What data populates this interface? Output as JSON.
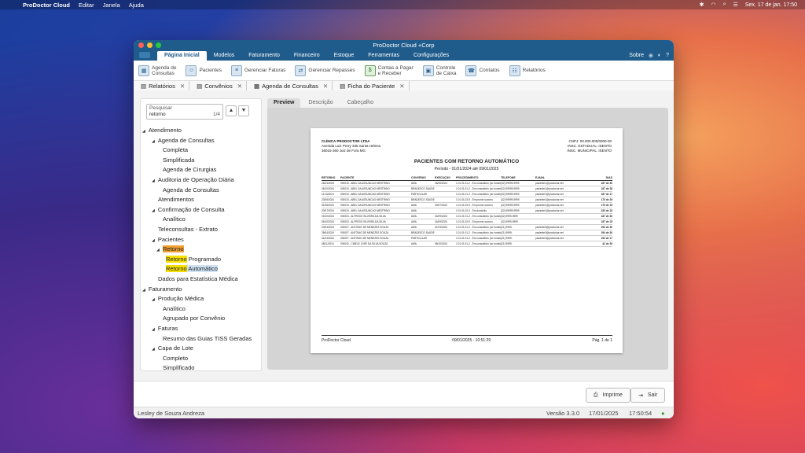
{
  "menubar": {
    "app": "ProDoctor Cloud",
    "items": [
      "Editar",
      "Janela",
      "Ajuda"
    ],
    "datetime": "Sex. 17 de jan.  17:50"
  },
  "window": {
    "title": "ProDoctor Cloud +Corp",
    "ribbon_tabs": [
      "Página Inicial",
      "Modelos",
      "Faturamento",
      "Financeiro",
      "Estoque",
      "Ferramentas",
      "Configurações"
    ],
    "ribbon_right": "Sobre",
    "toolbar": [
      {
        "label": "Agenda de\nConsultas",
        "icon": "calendar-icon"
      },
      {
        "label": "Pacientes",
        "icon": "patients-icon"
      },
      {
        "label": "Gerenciar Faturas",
        "icon": "invoices-icon"
      },
      {
        "label": "Gerenciar Repasses",
        "icon": "transfers-icon"
      },
      {
        "label": "Contas a Pagar\ne Receber",
        "icon": "accounts-icon"
      },
      {
        "label": "Controle\nde Caixa",
        "icon": "cashier-icon"
      },
      {
        "label": "Contatos",
        "icon": "contacts-icon"
      },
      {
        "label": "Relatórios",
        "icon": "reports-icon"
      }
    ],
    "doc_tabs": [
      "Relatórios",
      "Convênios",
      "Agenda de Consultas",
      "Ficha do Paciente"
    ]
  },
  "search": {
    "placeholder": "Pesquisar",
    "value": "retorno",
    "count": "1/4"
  },
  "tree": [
    {
      "label": "Atendimento",
      "level": 0,
      "expanded": true
    },
    {
      "label": "Agenda de Consultas",
      "level": 1,
      "expanded": true
    },
    {
      "label": "Completa",
      "level": 2
    },
    {
      "label": "Simplificada",
      "level": 2
    },
    {
      "label": "Agenda de Cirurgias",
      "level": 2
    },
    {
      "label": "Auditoria de Operação Diária",
      "level": 1,
      "expanded": true
    },
    {
      "label": "Agenda de Consultas",
      "level": 2
    },
    {
      "label": "Atendimentos",
      "level": 1
    },
    {
      "label": "Confirmação de Consulta",
      "level": 1,
      "expanded": true
    },
    {
      "label": "Analítico",
      "level": 2
    },
    {
      "label": "Teleconsultas - Extrato",
      "level": 1
    },
    {
      "label": "Pacientes",
      "level": 1,
      "expanded": true
    },
    {
      "label": "Retorno",
      "level": 2,
      "expanded": true,
      "match": "Retorno",
      "rest": "",
      "hl": "orange"
    },
    {
      "label": "Retorno Programado",
      "level": 3,
      "match": "Retorno",
      "rest": " Programado",
      "hl": "yellow"
    },
    {
      "label": "Retorno Automático",
      "level": 3,
      "match": "Retorno",
      "rest": " Automático",
      "hl": "yellow",
      "selected": true
    },
    {
      "label": "Dados para Estatística Médica",
      "level": 1
    },
    {
      "label": "Faturamento",
      "level": 0,
      "expanded": true
    },
    {
      "label": "Produção Médica",
      "level": 1,
      "expanded": true
    },
    {
      "label": "Analítico",
      "level": 2
    },
    {
      "label": "Agrupado por Convênio",
      "level": 2
    },
    {
      "label": "Faturas",
      "level": 1,
      "expanded": true
    },
    {
      "label": "Resumo das Guias TISS Geradas",
      "level": 2
    },
    {
      "label": "Capa de Lote",
      "level": 1,
      "expanded": true
    },
    {
      "label": "Completo",
      "level": 2
    },
    {
      "label": "Simplificado",
      "level": 2
    }
  ],
  "preview_tabs": [
    "Preview",
    "Descrição",
    "Cabeçalho"
  ],
  "report": {
    "company": "CLÍNICA PRODOCTOR LTDA",
    "address1": "Avenida Luiz Perry 335 Santa Helena",
    "address2": "36015-360 Juiz de Fora MG",
    "cnpj": "CNPJ: 00.000.000/0000-00",
    "insc_est": "INSC. ESTADUAL: ISENTO",
    "insc_mun": "INSC. MUNICIPAL: ISENTO",
    "title": "PACIENTES COM RETORNO AUTOMÁTICO",
    "period": "Período - 01/01/2024 até 09/01/2025",
    "columns": [
      "RETORNO",
      "PACIENTE",
      "CONVÊNIO",
      "EXECUÇÃO",
      "PROCEDIMENTO",
      "TELEFONE",
      "E-MAIL",
      "DIAS"
    ],
    "rows": [
      [
        "26/03/2024",
        "000015 - ABEL DA ASSUNCAO MESTRINO",
        "AMIL",
        "26/06/2024",
        "1.01.01.01-2 - Em consultório (no horário normal ou pré...",
        "(32) 99999-9999",
        "paciente1@prodoctor.net",
        "187 de 30"
      ],
      [
        "26/10/2024",
        "000015 - ABEL DA ASSUNCAO MESTRINO",
        "BRADESCO SAÚDE",
        "",
        "1.01.01.01-2 - Em consultório (no horário normal ou pré...",
        "(32) 99999-9999",
        "paciente1@prodoctor.net",
        "187 de 28"
      ],
      [
        "11/10/2024",
        "000015 - ABEL DA ASSUNCAO MESTRINO",
        "PARTICULAR",
        "",
        "1.01.01.01-2 - Em consultório (no horário normal ou pré...",
        "(32) 99999-9999",
        "paciente1@prodoctor.net",
        "187 de 17"
      ],
      [
        "23/08/2024",
        "000015 - ABEL DA ASSUNCAO MESTRINO",
        "BRADESCO SAÚDE",
        "",
        "1.01.01.03-9 - Em pronto socorro",
        "(32) 99999-9999",
        "paciente1@prodoctor.net",
        "170 de 29"
      ],
      [
        "31/08/2024",
        "000015 - ABEL DA ASSUNCAO MESTRINO",
        "AMIL",
        "20/07/2024",
        "1.01.01.03-9 - Em pronto socorro",
        "(32) 99999-9999",
        "paciente1@prodoctor.net",
        "170 de 15"
      ],
      [
        "20/07/2024",
        "000015 - ABEL DA ASSUNCAO MESTRINO",
        "AMIL",
        "",
        "1.01.01.02-0 - Em domicílio",
        "(32) 99999-9999",
        "paciente1@prodoctor.net",
        "333 de 15"
      ],
      [
        "24/10/2024",
        "000003 - ALFREDO SILVEIRA DA SILVA",
        "AMIL",
        "24/09/2024",
        "1.01.01.01-2 - Em consultório (no horário normal ou pré...",
        "(32) 9999-9999",
        "",
        "187 de 30"
      ],
      [
        "06/10/2024",
        "000003 - ALFREDO SILVEIRA DA SILVA",
        "AMIL",
        "24/09/2024",
        "1.01.01.03-9 - Em pronto socorro",
        "(32) 9999-9999",
        "",
        "187 de 15"
      ],
      [
        "20/04/2024",
        "000007 - ANTÔNIO DE MENEZES SOUZA",
        "AMIL",
        "21/03/2024",
        "1.01.01.01-2 - Em consultório (no horário normal ou pré...",
        "(21) 9999-",
        "paciente3@prodoctor.net",
        "294 de 30"
      ],
      [
        "28/04/2024",
        "000007 - ANTÔNIO DE MENEZES SOUZA",
        "BRADESCO SAÚDE",
        "",
        "1.01.01.01-2 - Em consultório (no horário normal ou pré...",
        "(21) 9999-",
        "paciente3@prodoctor.net",
        "294 de 30"
      ],
      [
        "01/04/2024",
        "000007 - ANTÔNIO DE MENEZES SOUZA",
        "PARTICULAR",
        "",
        "1.01.01.01-2 - Em consultório (no horário normal ou pré...",
        "(21) 9999-",
        "paciente3@prodoctor.net",
        "294 de 17"
      ],
      [
        "08/11/2024",
        "000042 - CIBELE JOSÉ DA SILVA SOUZA",
        "AMIL",
        "08/10/2024",
        "1.01.01.01-2 - Em consultório (no horário normal ou pré...",
        "(21) 9999-",
        "",
        "42 de 30"
      ]
    ],
    "footer_left": "ProDoctor Cloud",
    "footer_center": "09/01/2025 - 10:51:29",
    "footer_right": "Pág. 1 de 1"
  },
  "buttons": {
    "print": "Imprime",
    "exit": "Sair"
  },
  "status": {
    "user": "Lesley de Souza Andreza",
    "version": "Versão 3.3.0",
    "date": "17/01/2025",
    "time": "17:50:54"
  },
  "colors": {
    "titlebar": "#1f5c8b",
    "highlight_yellow": "#f7e000",
    "highlight_orange": "#f0a030",
    "selection": "#cfe3f5"
  }
}
